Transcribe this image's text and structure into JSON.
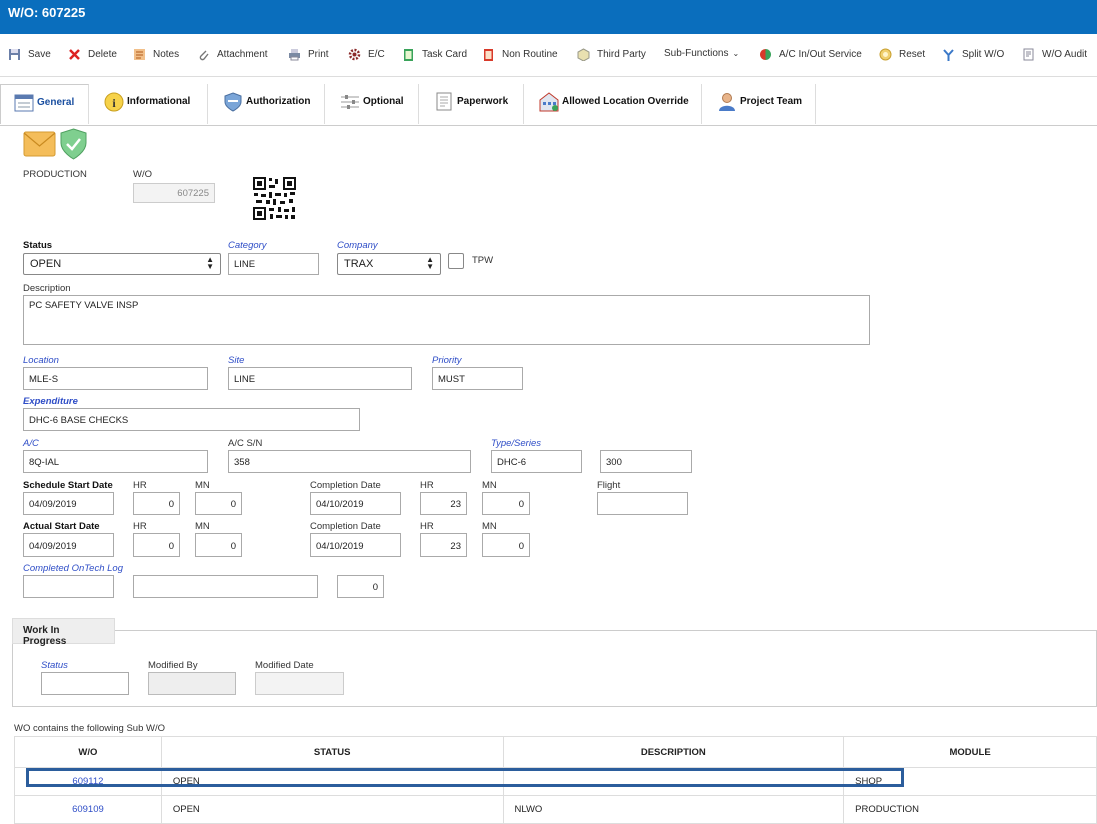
{
  "window": {
    "title": "W/O: 607225"
  },
  "toolbar": {
    "items": [
      {
        "label": "Save",
        "icon": "save-icon"
      },
      {
        "label": "Delete",
        "icon": "delete-icon"
      },
      {
        "label": "Notes",
        "icon": "notes-icon"
      },
      {
        "label": "Attachment",
        "icon": "attachment-icon"
      },
      {
        "label": "Print",
        "icon": "print-icon"
      },
      {
        "label": "E/C",
        "icon": "gear-icon"
      },
      {
        "label": "Task Card",
        "icon": "task-card-icon"
      },
      {
        "label": "Non Routine",
        "icon": "non-routine-icon"
      },
      {
        "label": "Third Party",
        "icon": "third-party-icon"
      },
      {
        "label": "Sub-Functions",
        "icon": "chevron-down-icon"
      },
      {
        "label": "A/C In/Out Service",
        "icon": "service-icon"
      },
      {
        "label": "Reset",
        "icon": "reset-icon"
      },
      {
        "label": "Split W/O",
        "icon": "split-icon"
      },
      {
        "label": "W/O Audit",
        "icon": "audit-icon"
      }
    ]
  },
  "tabs": [
    {
      "label": "General",
      "active": true
    },
    {
      "label": "Informational"
    },
    {
      "label": "Authorization"
    },
    {
      "label": "Optional"
    },
    {
      "label": "Paperwork"
    },
    {
      "label": "Allowed Location Override"
    },
    {
      "label": "Project Team"
    }
  ],
  "general": {
    "type_label": "PRODUCTION",
    "wo_label": "W/O",
    "wo_value": "607225",
    "status_label": "Status",
    "status_value": "OPEN",
    "category_label": "Category",
    "category_value": "LINE",
    "company_label": "Company",
    "company_value": "TRAX",
    "tpw_label": "TPW",
    "description_label": "Description",
    "description_value": "PC SAFETY VALVE INSP",
    "location_label": "Location",
    "location_value": "MLE-S",
    "site_label": "Site",
    "site_value": "LINE",
    "priority_label": "Priority",
    "priority_value": "MUST",
    "expenditure_label": "Expenditure",
    "expenditure_value": "DHC-6 BASE CHECKS",
    "ac_label": "A/C",
    "ac_value": "8Q-IAL",
    "acsn_label": "A/C S/N",
    "acsn_value": "358",
    "type_series_label": "Type/Series",
    "type_value": "DHC-6",
    "series_value": "300",
    "sched_label": "Schedule Start Date",
    "sched_date": "04/09/2019",
    "sched_hr": "0",
    "sched_mn": "0",
    "sched_comp_label": "Completion Date",
    "sched_comp_date": "04/10/2019",
    "sched_comp_hr": "23",
    "sched_comp_mn": "0",
    "flight_label": "Flight",
    "flight_value": "",
    "actual_label": "Actual Start Date",
    "actual_date": "04/09/2019",
    "actual_hr": "0",
    "actual_mn": "0",
    "actual_comp_label": "Completion Date",
    "actual_comp_date": "04/10/2019",
    "actual_comp_hr": "23",
    "actual_comp_mn": "0",
    "hr_label": "HR",
    "mn_label": "MN",
    "ontech_label": "Completed OnTech Log",
    "ontech_count": "0"
  },
  "wip": {
    "title": "Work In Progress",
    "status_label": "Status",
    "modified_by_label": "Modified By",
    "modified_date_label": "Modified Date"
  },
  "sub_wo": {
    "caption": "WO contains the following Sub W/O",
    "columns": [
      "W/O",
      "STATUS",
      "DESCRIPTION",
      "MODULE"
    ],
    "rows": [
      {
        "wo": "609112",
        "status": "OPEN",
        "description": "",
        "module": "SHOP"
      },
      {
        "wo": "609109",
        "status": "OPEN",
        "description": "NLWO",
        "module": "PRODUCTION"
      }
    ]
  },
  "colors": {
    "accent": "#0a6ebd",
    "link": "#2f4ec7",
    "highlight": "#2b5d9c"
  }
}
